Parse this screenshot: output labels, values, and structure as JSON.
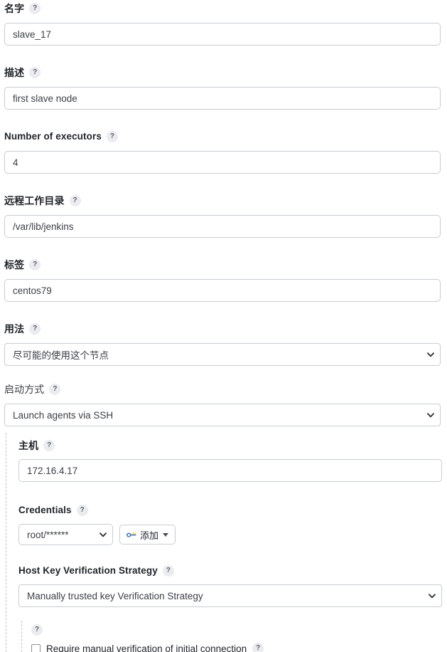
{
  "form": {
    "fields": [
      {
        "label": "名字",
        "help_icon": "help-icon",
        "value": "slave_17",
        "placeholder": "",
        "name": "node-name"
      },
      {
        "label": "描述",
        "help_icon": "help-icon",
        "value": "first slave node",
        "placeholder": "",
        "name": "description"
      },
      {
        "label": "Number of executors",
        "help_icon": "help-icon",
        "value": "4",
        "placeholder": "",
        "name": "num-executors"
      },
      {
        "label": "远程工作目录",
        "help_icon": "help-icon",
        "value": "/var/lib/jenkins",
        "placeholder": "",
        "name": "remote-root-dir"
      },
      {
        "label": "标签",
        "help_icon": "help-icon",
        "value": "centos79",
        "placeholder": "",
        "name": "labels"
      }
    ],
    "usage": {
      "label": "用法",
      "help_icon": "help-icon",
      "selected": "尽可能的使用这个节点"
    },
    "launch_method": {
      "label": "启动方式",
      "help_icon": "help-icon",
      "selected": "Launch agents via SSH"
    },
    "ssh": {
      "host": {
        "label": "主机",
        "help_icon": "help-icon",
        "value": "172.16.4.17",
        "placeholder": ""
      },
      "credentials": {
        "label": "Credentials",
        "help_icon": "help-icon",
        "selected": "root/******",
        "add_button": {
          "label": "添加",
          "icon": "key-icon",
          "caret": "caret-down-icon"
        }
      },
      "host_key_strategy": {
        "label": "Host Key Verification Strategy",
        "help_icon": "help-icon",
        "selected": "Manually trusted key Verification Strategy"
      },
      "manual_verification": {
        "section_help_icon": "help-icon",
        "checkbox_label": "Require manual verification of initial connection",
        "checkbox_help_icon": "help-icon",
        "checked": false
      }
    }
  },
  "colors": {
    "border": "#c8cdd3",
    "text": "#1f2328",
    "help_bg": "#ebecef",
    "help_fg": "#5a6069",
    "dashed": "#bfc4ca",
    "key_blue": "#3b6fb6",
    "key_yellow": "#f0c419"
  }
}
